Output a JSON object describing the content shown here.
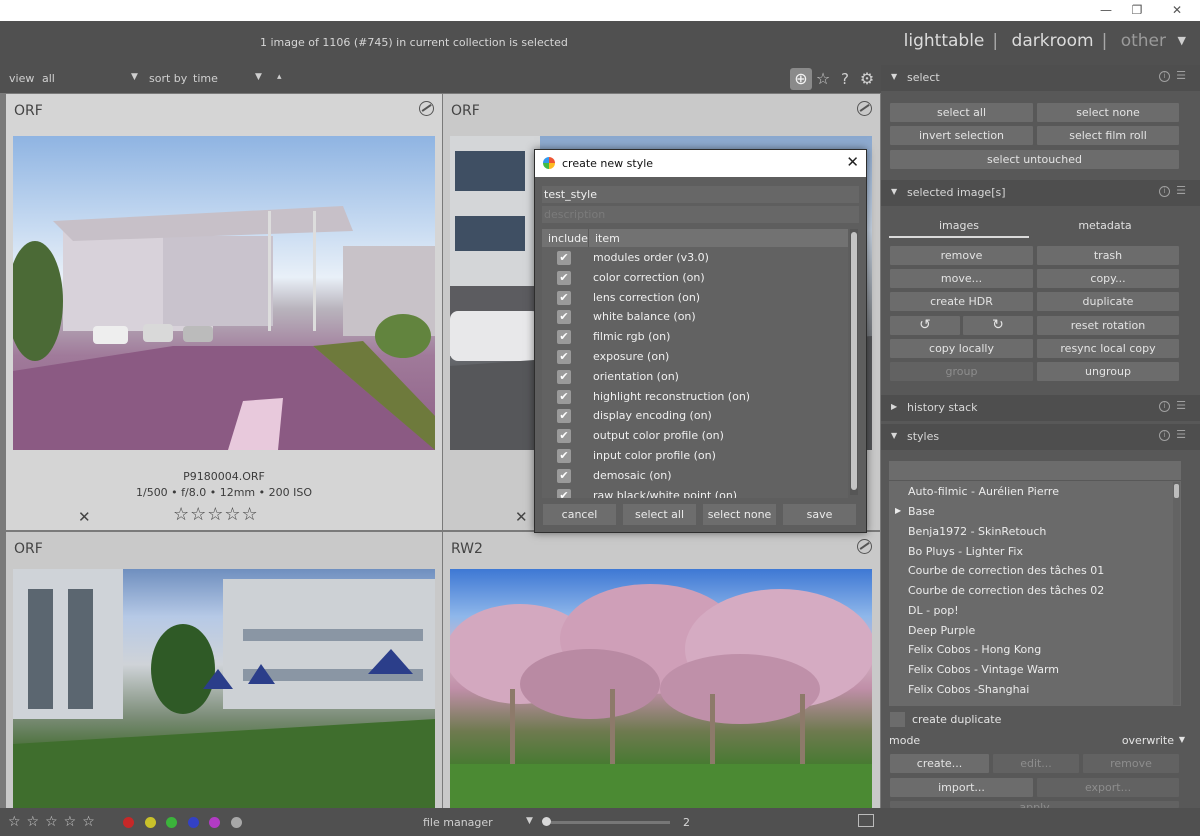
{
  "os": {
    "minimize": "—",
    "restore": "❐",
    "close": "✕"
  },
  "header": {
    "status": "1 image of 1106 (#745) in current collection is selected",
    "views": [
      "lighttable",
      "darkroom",
      "other"
    ]
  },
  "toolbar": {
    "view_label": "view",
    "view_value": "all",
    "sortby_label": "sort by",
    "sortby_value": "time",
    "sort_dir": "▴"
  },
  "thumbnails": [
    {
      "ext": "ORF",
      "filename": "P9180004.ORF",
      "exif": "1/500 • f/8.0 • 12mm • 200 ISO",
      "stars": "☆☆☆☆☆",
      "reject": "✕"
    },
    {
      "ext": "ORF",
      "reject": "✕"
    },
    {
      "ext": "ORF"
    },
    {
      "ext": "RW2"
    }
  ],
  "bottombar": {
    "stars": "☆☆☆☆☆",
    "color_labels": [
      "#c62828",
      "#c9c12a",
      "#3bb33b",
      "#3341c4",
      "#b23bc4",
      "#a8a8a8"
    ],
    "layout_label": "file manager",
    "zoom": "2"
  },
  "panel": {
    "select": {
      "title": "select",
      "select_all": "select all",
      "select_none": "select none",
      "invert": "invert selection",
      "film_roll": "select film roll",
      "untouched": "select untouched"
    },
    "selected": {
      "title": "selected image[s]",
      "tab_images": "images",
      "tab_metadata": "metadata",
      "remove": "remove",
      "trash": "trash",
      "move": "move...",
      "copy": "copy...",
      "create_hdr": "create HDR",
      "duplicate": "duplicate",
      "rot_ccw": "↺",
      "rot_cw": "↻",
      "reset_rotation": "reset rotation",
      "copy_locally": "copy locally",
      "resync": "resync local copy",
      "group": "group",
      "ungroup": "ungroup"
    },
    "history": {
      "title": "history stack"
    },
    "styles": {
      "title": "styles",
      "items": [
        "Auto-filmic - Aurélien Pierre",
        "Base",
        "Benja1972 - SkinRetouch",
        "Bo Pluys - Lighter Fix",
        "Courbe de correction des tâches 01",
        "Courbe de correction des tâches 02",
        "DL - pop!",
        "Deep Purple",
        "Felix Cobos - Hong Kong",
        "Felix Cobos - Vintage Warm",
        "Felix Cobos -Shanghai"
      ],
      "create_duplicate": "create duplicate",
      "mode_label": "mode",
      "mode_value": "overwrite",
      "create": "create...",
      "edit": "edit...",
      "remove": "remove",
      "import": "import...",
      "export": "export...",
      "apply": "apply"
    }
  },
  "dialog": {
    "title": "create new style",
    "close": "✕",
    "name_value": "test_style",
    "description_placeholder": "description",
    "col_include": "include",
    "col_item": "item",
    "check": "✔",
    "items": [
      "modules order (v3.0)",
      "color correction  (on)",
      "lens correction  (on)",
      "white balance  (on)",
      "filmic rgb  (on)",
      "exposure  (on)",
      "orientation  (on)",
      "highlight reconstruction  (on)",
      "display encoding  (on)",
      "output color profile  (on)",
      "input color profile  (on)",
      "demosaic  (on)",
      "raw black/white point  (on)"
    ],
    "btn_cancel": "cancel",
    "btn_select_all": "select all",
    "btn_select_none": "select none",
    "btn_save": "save"
  }
}
